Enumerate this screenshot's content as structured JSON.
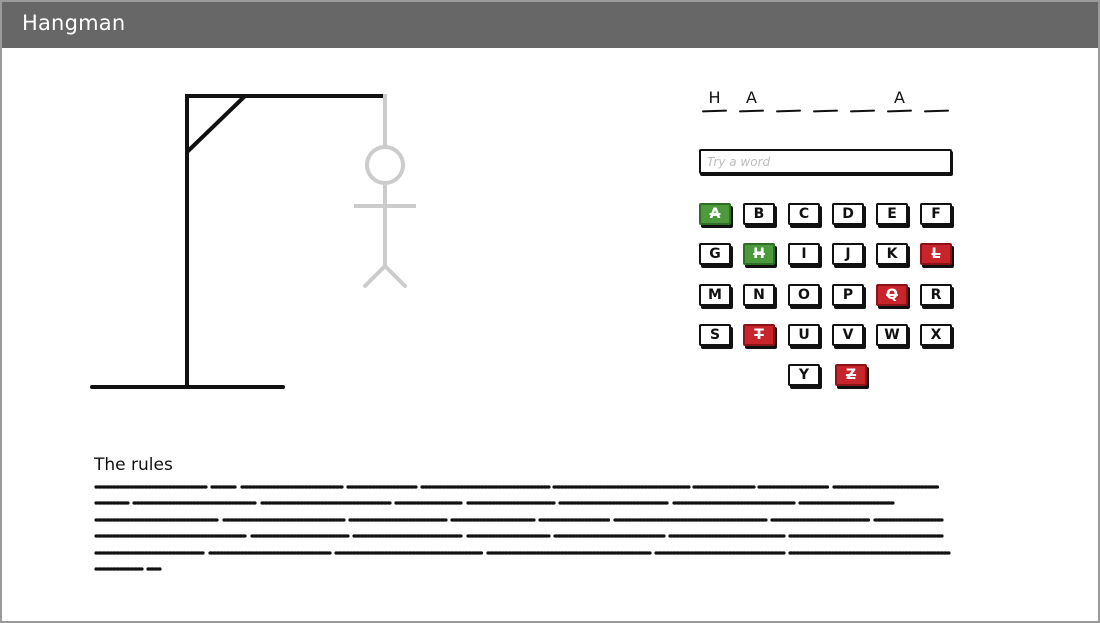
{
  "window": {
    "title": "Hangman"
  },
  "word": {
    "slots": [
      "H",
      "A",
      "",
      "",
      "",
      "A",
      ""
    ]
  },
  "guess_input": {
    "placeholder": "Try a word",
    "value": ""
  },
  "keyboard": {
    "keys": [
      {
        "letter": "A",
        "state": "hit"
      },
      {
        "letter": "B",
        "state": "unused"
      },
      {
        "letter": "C",
        "state": "unused"
      },
      {
        "letter": "D",
        "state": "unused"
      },
      {
        "letter": "E",
        "state": "unused"
      },
      {
        "letter": "F",
        "state": "unused"
      },
      {
        "letter": "G",
        "state": "unused"
      },
      {
        "letter": "H",
        "state": "hit"
      },
      {
        "letter": "I",
        "state": "unused"
      },
      {
        "letter": "J",
        "state": "unused"
      },
      {
        "letter": "K",
        "state": "unused"
      },
      {
        "letter": "L",
        "state": "miss"
      },
      {
        "letter": "M",
        "state": "unused"
      },
      {
        "letter": "N",
        "state": "unused"
      },
      {
        "letter": "O",
        "state": "unused"
      },
      {
        "letter": "P",
        "state": "unused"
      },
      {
        "letter": "Q",
        "state": "miss"
      },
      {
        "letter": "R",
        "state": "unused"
      },
      {
        "letter": "S",
        "state": "unused"
      },
      {
        "letter": "T",
        "state": "miss"
      },
      {
        "letter": "U",
        "state": "unused"
      },
      {
        "letter": "V",
        "state": "unused"
      },
      {
        "letter": "W",
        "state": "unused"
      },
      {
        "letter": "X",
        "state": "unused"
      },
      {
        "letter": "Y",
        "state": "unused"
      },
      {
        "letter": "Z",
        "state": "miss"
      }
    ]
  },
  "colors": {
    "hit": "#4c9a3c",
    "miss": "#c8242b",
    "titlebar": "#676767",
    "figure": "#cccccc"
  },
  "rules": {
    "title": "The rules"
  }
}
